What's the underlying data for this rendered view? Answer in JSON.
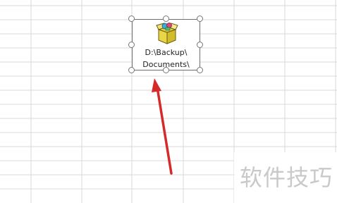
{
  "object": {
    "icon": "package-icon",
    "label_line1": "D:\\Backup\\",
    "label_line2": "Documents\\"
  },
  "annotation": {
    "arrow_color": "#d42a2a"
  },
  "watermark": {
    "text": "软件技巧"
  },
  "colors": {
    "gridline": "#dadada",
    "selection_border": "#6e6e6e"
  }
}
